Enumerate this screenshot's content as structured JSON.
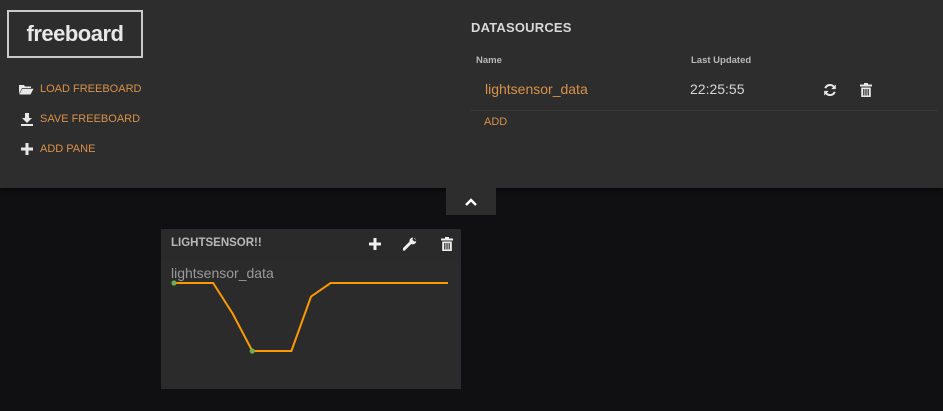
{
  "header": {
    "logo_text": "freeboard",
    "actions": [
      {
        "label": "LOAD FREEBOARD",
        "icon": "folder-open-icon"
      },
      {
        "label": "SAVE FREEBOARD",
        "icon": "download-icon"
      },
      {
        "label": "ADD PANE",
        "icon": "plus-icon"
      }
    ]
  },
  "datasources": {
    "title": "DATASOURCES",
    "columns": [
      "Name",
      "Last Updated"
    ],
    "rows": [
      {
        "name": "lightsensor_data",
        "last_updated": "22:25:55"
      }
    ],
    "add_label": "ADD"
  },
  "pane": {
    "title": "LIGHTSENSOR!!",
    "widget": {
      "title": "lightsensor_data",
      "sparkline": [
        1,
        1,
        1,
        0.55,
        0,
        0,
        0,
        0.8,
        1,
        1,
        1,
        1,
        1,
        1,
        1
      ],
      "line_color": "#ff9900",
      "dot_color": "#6ab04c"
    }
  },
  "colors": {
    "accent": "#d9924a",
    "panel_bg": "#2d2d2d",
    "page_bg": "#101012"
  }
}
